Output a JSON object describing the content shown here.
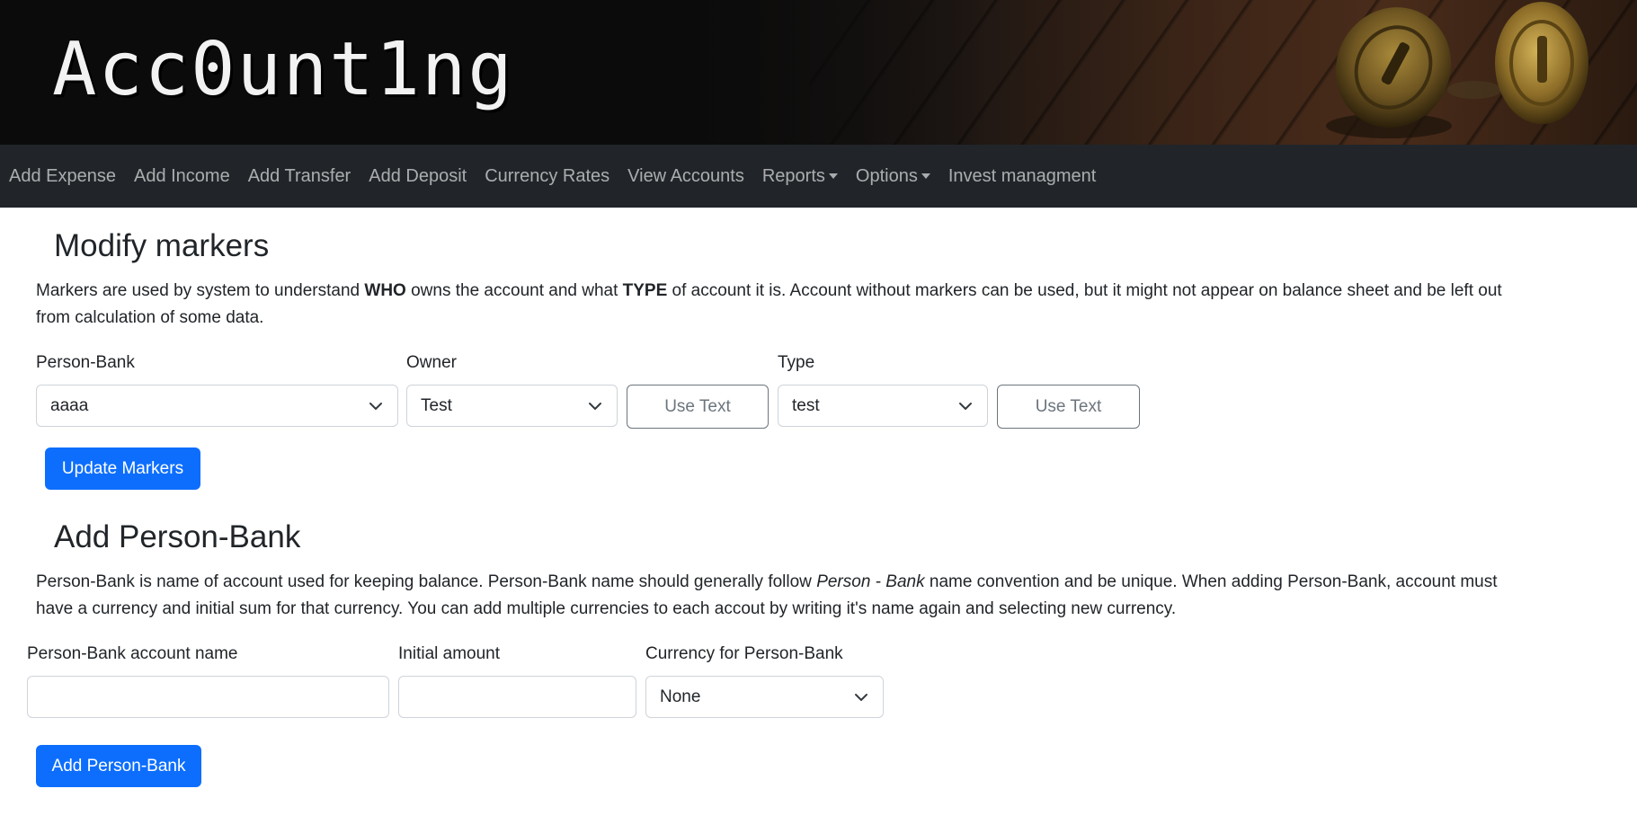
{
  "header": {
    "brand": "Acc0unt1ng"
  },
  "nav": {
    "items": [
      {
        "label": "Add Expense",
        "dropdown": false
      },
      {
        "label": "Add Income",
        "dropdown": false
      },
      {
        "label": "Add Transfer",
        "dropdown": false
      },
      {
        "label": "Add Deposit",
        "dropdown": false
      },
      {
        "label": "Currency Rates",
        "dropdown": false
      },
      {
        "label": "View Accounts",
        "dropdown": false
      },
      {
        "label": "Reports",
        "dropdown": true
      },
      {
        "label": "Options",
        "dropdown": true
      },
      {
        "label": "Invest managment",
        "dropdown": false
      }
    ]
  },
  "modify_markers": {
    "title": "Modify markers",
    "description_parts": {
      "p1": "Markers are used by system to understand ",
      "b1": "WHO",
      "p2": " owns the account and what ",
      "b2": "TYPE",
      "p3": " of account it is. Account without markers can be used, but it might not appear on balance sheet and be left out from calculation of some data."
    },
    "person_bank": {
      "label": "Person-Bank",
      "value": "aaaa"
    },
    "owner": {
      "label": "Owner",
      "value": "Test",
      "use_text_label": "Use Text"
    },
    "type": {
      "label": "Type",
      "value": "test",
      "use_text_label": "Use Text"
    },
    "submit_label": "Update Markers"
  },
  "add_person_bank": {
    "title": "Add Person-Bank",
    "description_parts": {
      "p1": "Person-Bank is name of account used for keeping balance. Person-Bank name should generally follow ",
      "em1": "Person - Bank",
      "p2": " name convention and be unique. When adding Person-Bank, account must have a currency and initial sum for that currency. You can add multiple currencies to each accout by writing it's name again and selecting new currency."
    },
    "account_name": {
      "label": "Person-Bank account name",
      "value": ""
    },
    "initial_amount": {
      "label": "Initial amount",
      "value": ""
    },
    "currency": {
      "label": "Currency for Person-Bank",
      "value": "None"
    },
    "submit_label": "Add Person-Bank"
  },
  "colors": {
    "navbar_bg": "#212529",
    "primary": "#0d6efd",
    "secondary": "#6c757d"
  }
}
